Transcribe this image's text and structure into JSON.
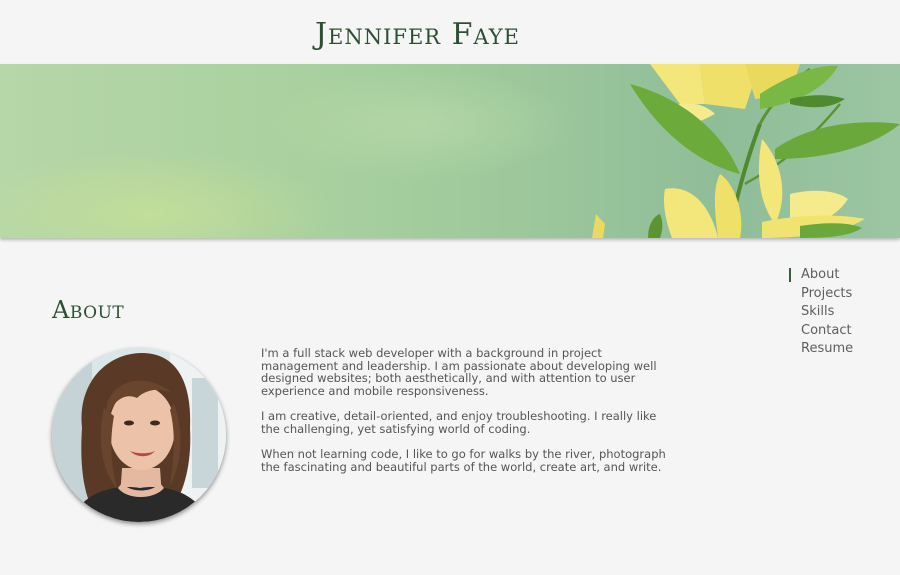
{
  "header": {
    "site_title": "Jennifer Faye"
  },
  "nav": {
    "items": [
      {
        "label": "About",
        "active": true
      },
      {
        "label": "Projects",
        "active": false
      },
      {
        "label": "Skills",
        "active": false
      },
      {
        "label": "Contact",
        "active": false
      },
      {
        "label": "Resume",
        "active": false
      }
    ]
  },
  "about": {
    "heading": "About",
    "paragraphs": [
      "I'm a full stack web developer with a background in project management and leadership. I am passionate about developing well designed websites; both aesthetically, and with attention to user experience and mobile responsiveness.",
      "I am creative, detail-oriented, and enjoy troubleshooting. I really like the challenging, yet satisfying world of coding.",
      "When not learning code, I like to go for walks by the river, photograph the fascinating and beautiful parts of the world, create art, and write."
    ]
  },
  "colors": {
    "title_green": "#2f4f35",
    "page_background": "#f5f5f5",
    "body_text": "#555555",
    "nav_active_marker": "#3b5a3c"
  }
}
